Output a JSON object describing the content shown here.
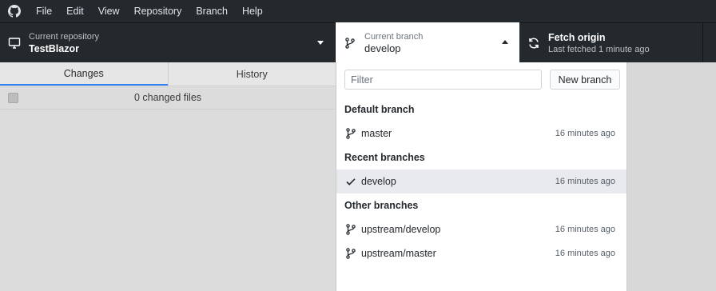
{
  "menu": [
    "File",
    "Edit",
    "View",
    "Repository",
    "Branch",
    "Help"
  ],
  "toolbar": {
    "repo_caption": "Current repository",
    "repo_name": "TestBlazor",
    "branch_caption": "Current branch",
    "branch_name": "develop",
    "fetch_title": "Fetch origin",
    "fetch_subtitle": "Last fetched 1 minute ago"
  },
  "tabs": {
    "changes": "Changes",
    "history": "History"
  },
  "changes": {
    "summary": "0 changed files"
  },
  "dropdown": {
    "filter_placeholder": "Filter",
    "new_branch_label": "New branch",
    "groups": [
      {
        "title": "Default branch",
        "branches": [
          {
            "name": "master",
            "time": "16 minutes ago",
            "icon": "branch-icon"
          }
        ]
      },
      {
        "title": "Recent branches",
        "branches": [
          {
            "name": "develop",
            "time": "16 minutes ago",
            "icon": "check-icon",
            "selected": true
          }
        ]
      },
      {
        "title": "Other branches",
        "branches": [
          {
            "name": "upstream/develop",
            "time": "16 minutes ago",
            "icon": "branch-icon"
          },
          {
            "name": "upstream/master",
            "time": "16 minutes ago",
            "icon": "branch-icon"
          }
        ]
      }
    ]
  },
  "colors": {
    "toolbar_bg": "#24292e",
    "accent": "#2f81f7",
    "selected_row": "#e8eaed"
  }
}
